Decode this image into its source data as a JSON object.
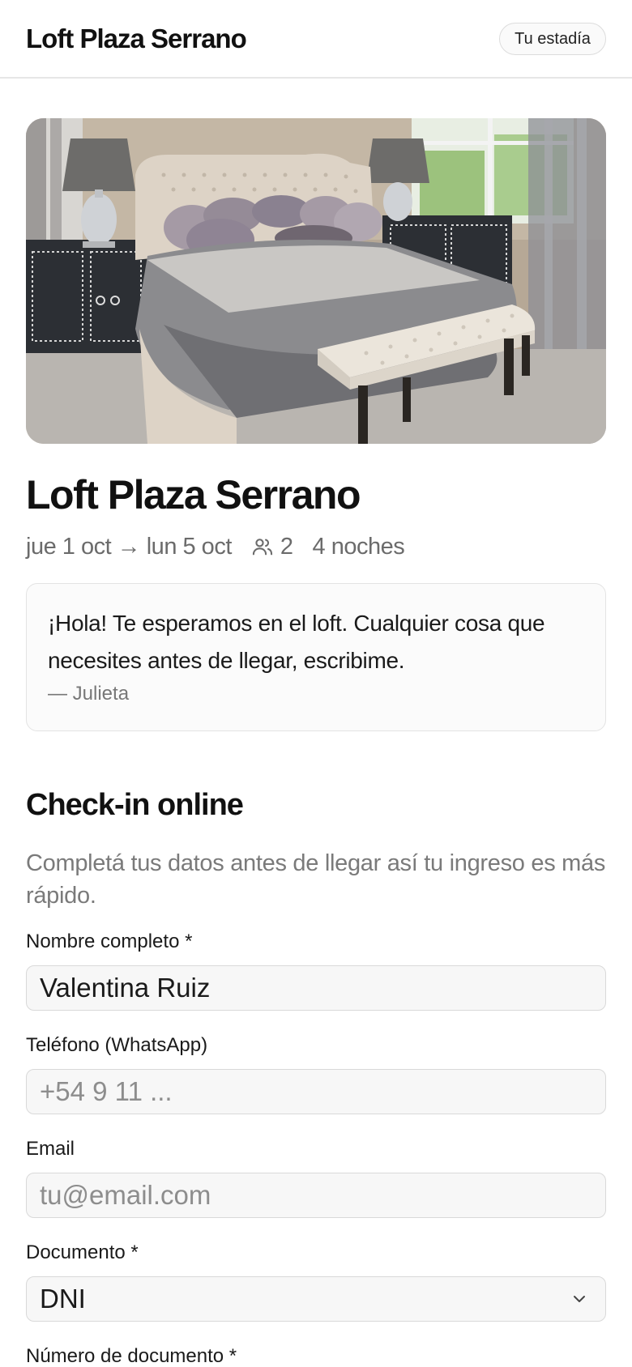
{
  "header": {
    "brand": "Loft Plaza Serrano",
    "stay_button": "Tu estadía"
  },
  "listing": {
    "title": "Loft Plaza Serrano",
    "dates": "jue 1 oct → lun 5 oct",
    "guests": "2",
    "nights": "4 noches"
  },
  "host_note": {
    "message": "¡Hola! Te esperamos en el loft. Cualquier cosa que necesites antes de llegar, escribime.",
    "signature": "— Julieta"
  },
  "checkin": {
    "title": "Check-in online",
    "description": "Completá tus datos antes de llegar así tu ingreso es más rápido.",
    "fields": {
      "name": {
        "label": "Nombre completo *",
        "value": "Valentina Ruiz"
      },
      "phone": {
        "label": "Teléfono (WhatsApp)",
        "placeholder": "+54 9 11 ...",
        "value": ""
      },
      "email": {
        "label": "Email",
        "placeholder": "tu@email.com",
        "value": ""
      },
      "document": {
        "label": "Documento *",
        "selected": "DNI"
      },
      "document_number": {
        "label": "Número de documento *"
      }
    }
  },
  "icons": {
    "guests": "users-icon",
    "select": "chevron-down-icon"
  },
  "colors": {
    "text": "#111111",
    "muted": "#6b6b6b",
    "border": "#d9d9d9",
    "field_bg": "#f7f7f7"
  }
}
